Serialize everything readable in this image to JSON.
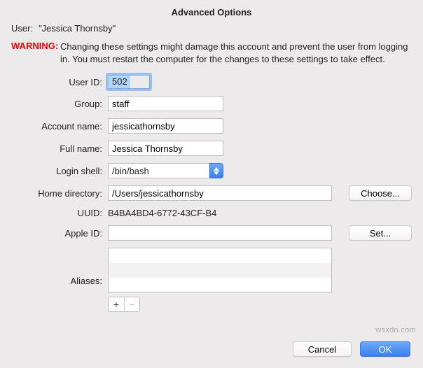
{
  "title": "Advanced Options",
  "userLabel": "User:",
  "userName": "\"Jessica Thornsby\"",
  "warning": {
    "label": "WARNING:",
    "text": "Changing these settings might damage this account and prevent the user from logging in. You must restart the computer for the changes to these settings to take effect."
  },
  "fields": {
    "userId": {
      "label": "User ID:",
      "value": "502"
    },
    "group": {
      "label": "Group:",
      "value": "staff"
    },
    "accountName": {
      "label": "Account name:",
      "value": "jessicathornsby"
    },
    "fullName": {
      "label": "Full name:",
      "value": "Jessica Thornsby"
    },
    "loginShell": {
      "label": "Login shell:",
      "value": "/bin/bash"
    },
    "homeDir": {
      "label": "Home directory:",
      "value": "/Users/jessicathornsby",
      "chooseLabel": "Choose..."
    },
    "uuid": {
      "label": "UUID:",
      "value": "B4BA4BD4-6772-43CF-B4"
    },
    "appleId": {
      "label": "Apple ID:",
      "value": "",
      "setLabel": "Set..."
    },
    "aliases": {
      "label": "Aliases:"
    }
  },
  "addRemove": {
    "add": "+",
    "remove": "−"
  },
  "footer": {
    "cancel": "Cancel",
    "ok": "OK"
  },
  "watermark": "wsxdn.com"
}
